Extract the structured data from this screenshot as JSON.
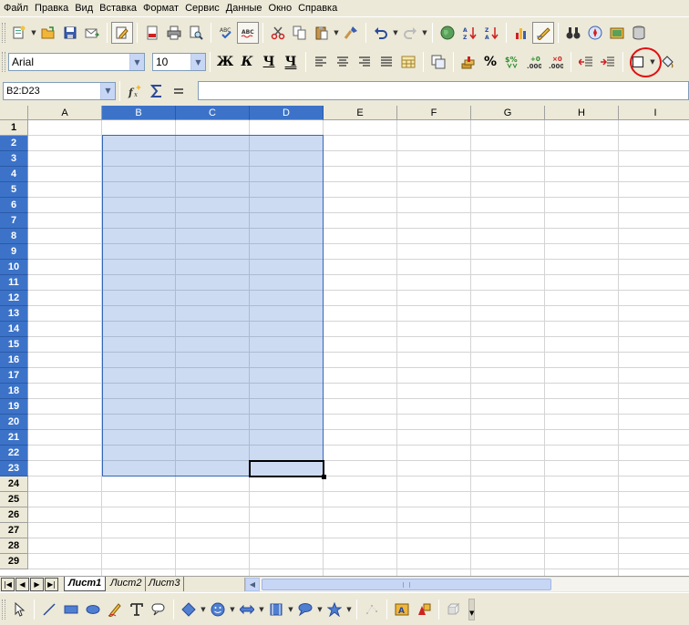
{
  "menu": [
    "Файл",
    "Правка",
    "Вид",
    "Вставка",
    "Формат",
    "Сервис",
    "Данные",
    "Окно",
    "Справка"
  ],
  "format_bar": {
    "font_name": "Arial",
    "font_size": "10",
    "bold": "Ж",
    "italic": "К",
    "underline": "Ч",
    "double_underline": "Ч",
    "percent": "%"
  },
  "formula_bar": {
    "name_box": "B2:D23",
    "input_value": ""
  },
  "columns": [
    "A",
    "B",
    "C",
    "D",
    "E",
    "F",
    "G",
    "H",
    "I"
  ],
  "rows": [
    "1",
    "2",
    "3",
    "4",
    "5",
    "6",
    "7",
    "8",
    "9",
    "10",
    "11",
    "12",
    "13",
    "14",
    "15",
    "16",
    "17",
    "18",
    "19",
    "20",
    "21",
    "22",
    "23",
    "24",
    "25",
    "26",
    "27",
    "28",
    "29"
  ],
  "selection": {
    "range": "B2:D23",
    "active_cell": "D23"
  },
  "sheets": [
    {
      "label": "Лист1",
      "active": true
    },
    {
      "label": "Лист2",
      "active": false
    },
    {
      "label": "Лист3",
      "active": false
    }
  ],
  "colors": {
    "selection_header": "#3c73c8",
    "selection_fill": "#c6d4ef",
    "highlight_circle": "#e01010"
  }
}
